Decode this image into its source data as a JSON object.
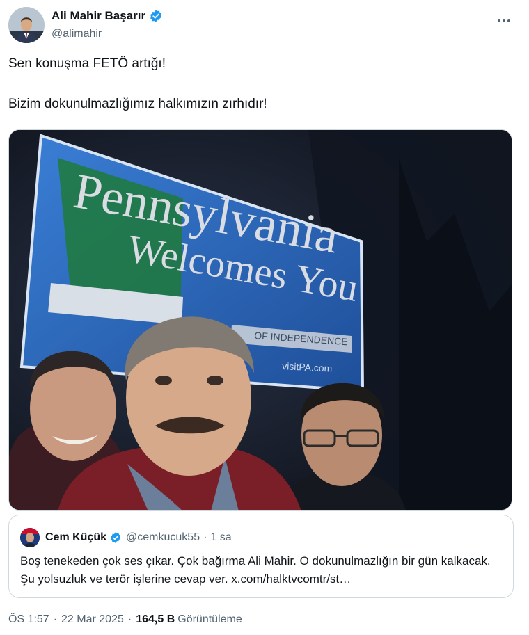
{
  "author": {
    "name": "Ali Mahir Başarır",
    "handle": "@alimahir",
    "verified_color": "#1d9bf0"
  },
  "more_icon": "more-horizontal-icon",
  "tweet": {
    "line1": "Sen konuşma FETÖ artığı!",
    "line2": "Bizim dokunulmazlığımız halkımızın zırhıdır!"
  },
  "photo": {
    "sign_line1": "Pennsylvania",
    "sign_line2": "Welcomes You",
    "sign_tag": "OF INDEPENDENCE",
    "sign_url": "visitPA.com"
  },
  "quote": {
    "name": "Cem Küçük",
    "handle": "@cemkucuk55",
    "separator": "·",
    "time": "1 sa",
    "text": "Boş tenekeden çok ses çıkar. Çok bağırma Ali Mahir. O dokunulmazlığın bir gün kalkacak. Şu yolsuzluk ve terör işlerine cevap ver. x.com/halktvcomtr/st…"
  },
  "meta": {
    "time": "ÖS 1:57",
    "date": "22 Mar 2025",
    "separator": "·",
    "views_count": "164,5 B",
    "views_label": "Görüntüleme"
  },
  "colors": {
    "text": "#0f1419",
    "secondary": "#536471",
    "border": "#cfd9de",
    "sign_blue": "#2f6bb8",
    "sign_green": "#1f7a3a"
  }
}
